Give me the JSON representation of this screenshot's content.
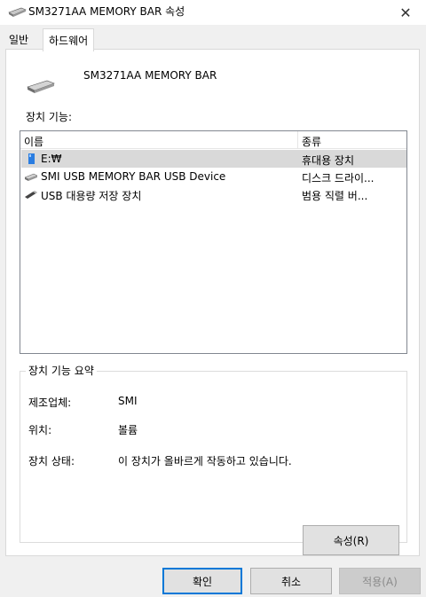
{
  "window": {
    "title": "SM3271AA MEMORY BAR 속성",
    "close_glyph": "✕"
  },
  "tabs": [
    {
      "label": "일반",
      "active": false
    },
    {
      "label": "하드웨어",
      "active": true
    }
  ],
  "device": {
    "name": "SM3271AA MEMORY BAR",
    "icon": "drive-icon"
  },
  "functions": {
    "label": "장치 기능:",
    "columns": {
      "name": "이름",
      "type": "종류"
    },
    "rows": [
      {
        "icon": "usb-stick-icon",
        "name": "E:₩",
        "type": "휴대용 장치",
        "selected": true
      },
      {
        "icon": "drive-icon",
        "name": "SMI USB MEMORY BAR USB Device",
        "type": "디스크 드라이...",
        "selected": false
      },
      {
        "icon": "usb-plug-icon",
        "name": "USB 대용량 저장 장치",
        "type": "범용 직렬 버...",
        "selected": false
      }
    ]
  },
  "summary": {
    "title": "장치 기능 요약",
    "manufacturer_label": "제조업체:",
    "manufacturer_value": "SMI",
    "location_label": "위치:",
    "location_value": "볼륨",
    "status_label": "장치 상태:",
    "status_value": "이 장치가 올바르게 작동하고 있습니다.",
    "properties_button": "속성(R)"
  },
  "footer": {
    "ok": "확인",
    "cancel": "취소",
    "apply": "적용(A)"
  },
  "colors": {
    "accent": "#0078d7",
    "selected_row": "#d9d9d9",
    "dialog_bg": "#f0f0f0"
  }
}
